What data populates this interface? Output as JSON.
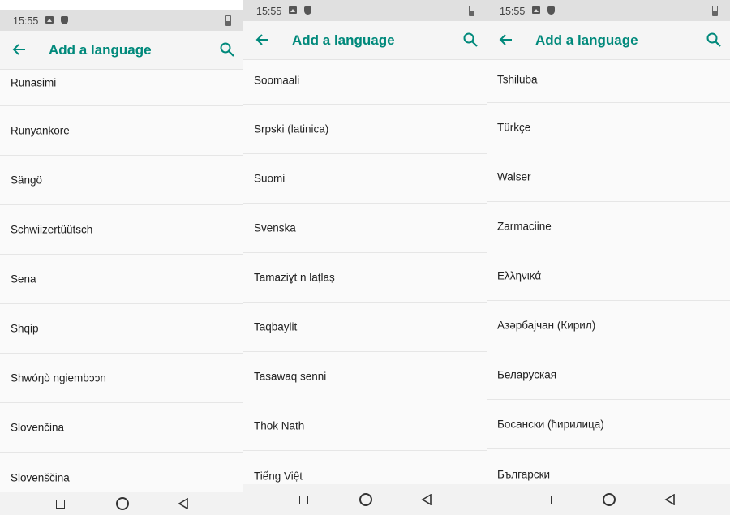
{
  "colors": {
    "accent": "#00897b",
    "statusbar": "#e0e0e0",
    "text": "#212121"
  },
  "screens": [
    {
      "status": {
        "time": "15:55"
      },
      "header": {
        "title": "Add a language"
      },
      "items": [
        "Runasimi",
        "Runyankore",
        "Sängö",
        "Schwiizertüütsch",
        "Sena",
        "Shqip",
        "Shwóŋò ngiembɔɔn",
        "Slovenčina",
        "Slovenščina"
      ]
    },
    {
      "status": {
        "time": "15:55"
      },
      "header": {
        "title": "Add a language"
      },
      "items": [
        "Soomaali",
        "Srpski (latinica)",
        "Suomi",
        "Svenska",
        "Tamaziɣt n laṭlaṣ",
        "Taqbaylit",
        "Tasawaq senni",
        "Thok Nath",
        "Tiếng Việt"
      ]
    },
    {
      "status": {
        "time": "15:55"
      },
      "header": {
        "title": "Add a language"
      },
      "items": [
        "Tshiluba",
        "Türkçe",
        "Walser",
        "Zarmaciine",
        "Ελληνικά",
        "Азәрбајҹан (Кирил)",
        "Беларуская",
        "Босански (ћирилица)",
        "Български"
      ]
    }
  ]
}
